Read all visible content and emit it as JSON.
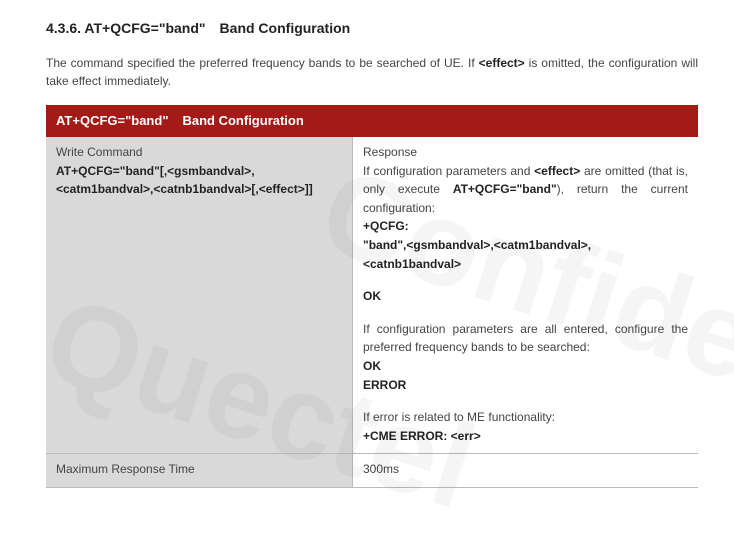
{
  "watermark": {
    "left": "Quectel",
    "right": "Confidential"
  },
  "section": {
    "number": "4.3.6.",
    "cmd": "AT+QCFG=\"band\"",
    "title": "Band Configuration"
  },
  "intro": {
    "prefix": "The command specified the preferred frequency bands to be searched of UE. If ",
    "effect": "<effect>",
    "suffix": " is omitted, the configuration will take effect immediately."
  },
  "header": {
    "cmd": "AT+QCFG=\"band\"",
    "title": "Band Configuration"
  },
  "rows": {
    "write": {
      "left_label": "Write Command",
      "left_cmd": "AT+QCFG=\"band\"[,<gsmbandval>,<catm1bandval>,<catnb1bandval>[,<effect>]]",
      "right_label": "Response",
      "p1_a": "If configuration parameters and ",
      "p1_b": "<effect>",
      "p1_c": " are omitted (that is, only execute ",
      "p1_d": "AT+QCFG=\"band\"",
      "p1_e": "), return the current configuration:",
      "resp1_l1": "+QCFG:",
      "resp1_l2": "\"band\",<gsmbandval>,<catm1bandval>,<catnb1bandval>",
      "ok1": "OK",
      "p2": "If configuration parameters are all entered, configure the preferred frequency bands to be searched:",
      "ok2": "OK",
      "err": "ERROR",
      "p3": "If error is related to ME functionality:",
      "cme": "+CME ERROR: <err>"
    },
    "mrt": {
      "label": "Maximum Response Time",
      "value": "300ms"
    }
  }
}
